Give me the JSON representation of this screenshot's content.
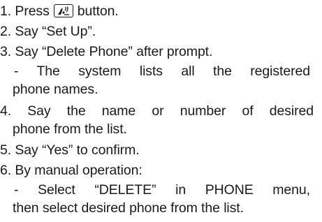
{
  "steps": {
    "s1": {
      "num": "1.",
      "pre": "Press",
      "icon": "voice-talk-icon",
      "post": "button."
    },
    "s2": "2. Say “Set Up”.",
    "s3": "3. Say “Delete Phone” after prompt.",
    "s3_sub_a": "- The system lists all the registered",
    "s3_sub_b": "phone names.",
    "s4_a": "4. Say the name or number of desired",
    "s4_b": "phone from the list.",
    "s5": "5. Say “Yes” to confirm.",
    "s6": "6. By manual operation:",
    "s6_sub_a": "- Select “DELETE” in PHONE menu,",
    "s6_sub_b": "then select desired phone from the list."
  }
}
